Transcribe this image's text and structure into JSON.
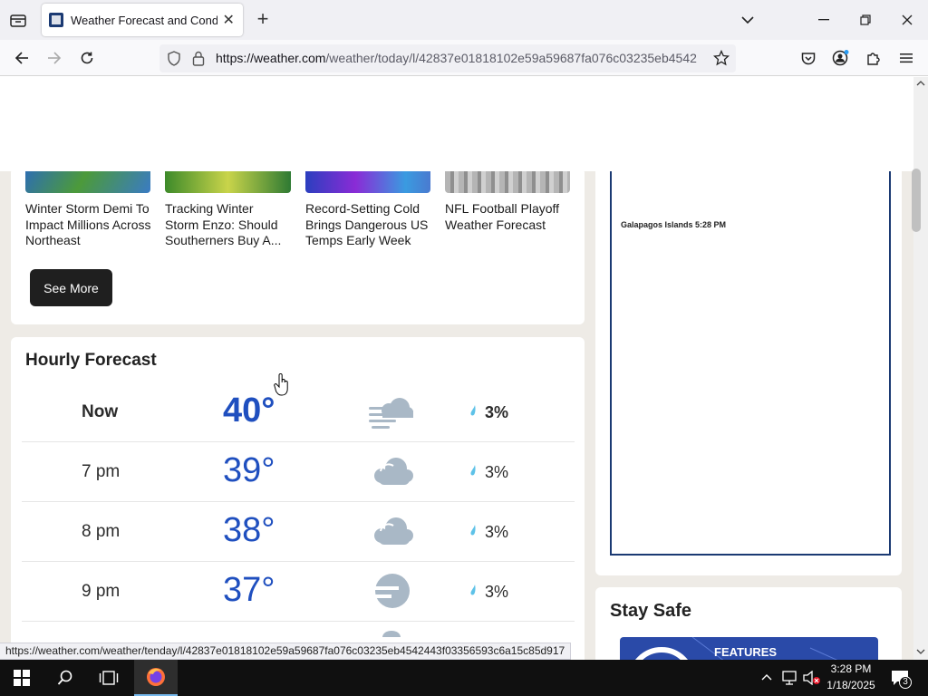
{
  "browser": {
    "tab_title": "Weather Forecast and Conditions for Austin, Texas - The Weather Channel | Weather.com",
    "url_domain": "https://weather.com",
    "url_path": "/weather/today/l/42837e01818102e59a59687fa076c03235eb4542",
    "status_url": "https://weather.com/weather/tenday/l/42837e01818102e59a59687fa076c03235eb4542443f03356593c6a15c85d917"
  },
  "news": {
    "items": [
      {
        "title": "Winter Storm Demi To Impact Millions Across Northeast"
      },
      {
        "title": "Tracking Winter Storm Enzo: Should Southerners Buy A..."
      },
      {
        "title": "Record-Setting Cold Brings Dangerous US Temps Early Week"
      },
      {
        "title": "NFL Football Playoff Weather Forecast"
      }
    ],
    "see_more_label": "See More"
  },
  "hourly": {
    "title": "Hourly Forecast",
    "rows": [
      {
        "time": "Now",
        "temp": "40°",
        "icon": "fog-cloud-icon",
        "precip": "3%"
      },
      {
        "time": "7 pm",
        "temp": "39°",
        "icon": "cloudy-icon",
        "precip": "3%"
      },
      {
        "time": "8 pm",
        "temp": "38°",
        "icon": "cloudy-icon",
        "precip": "3%"
      },
      {
        "time": "9 pm",
        "temp": "37°",
        "icon": "partly-cloudy-night-icon",
        "precip": "3%"
      }
    ]
  },
  "sidebar": {
    "map_label": "Galapagos Islands 5:28 PM",
    "stay_safe_title": "Stay Safe",
    "feature_label": "FEATURES"
  },
  "taskbar": {
    "time": "3:28 PM",
    "date": "1/18/2025",
    "notification_count": "3"
  },
  "colors": {
    "temp_blue": "#1f4fbf",
    "brand_navy": "#1b3a73",
    "icon_gray": "#a9b8c6",
    "drop_blue": "#5ec2e8"
  }
}
